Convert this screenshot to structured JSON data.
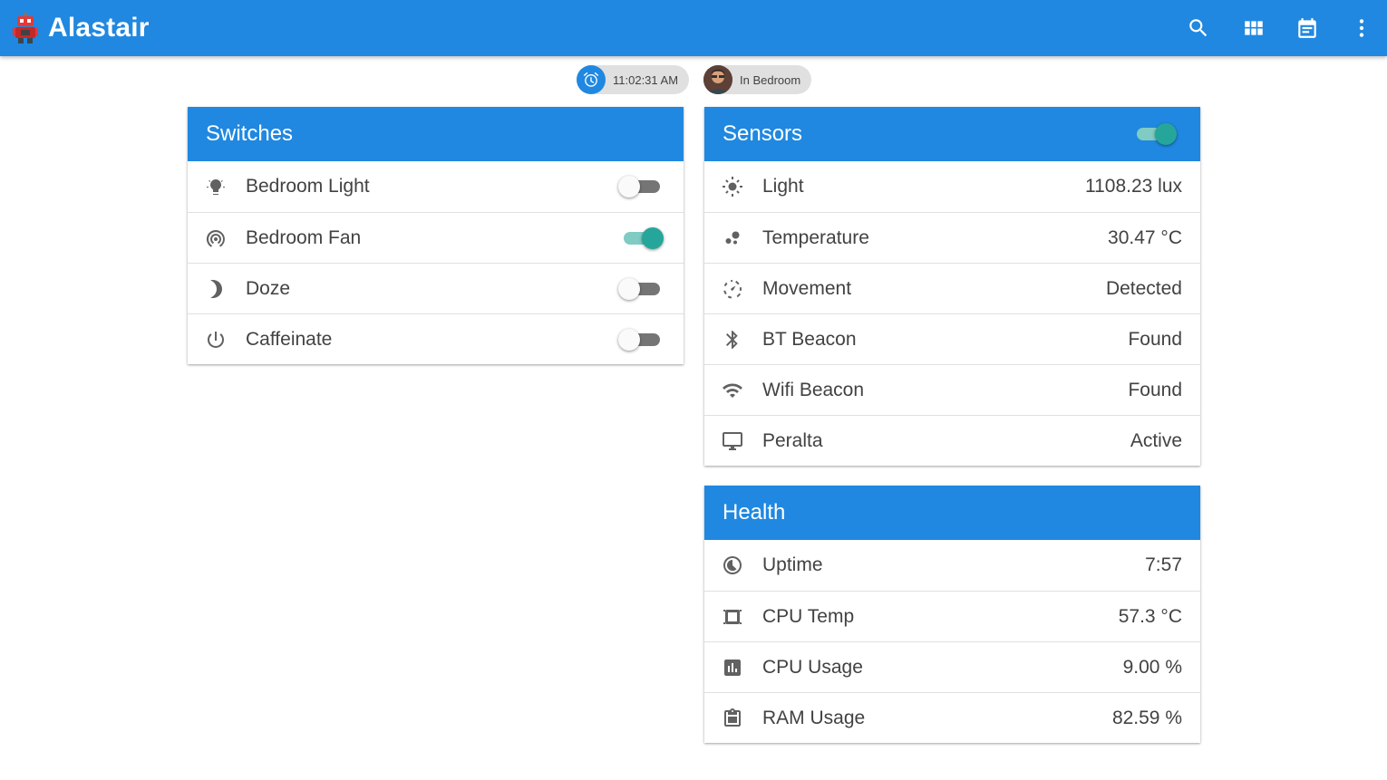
{
  "app": {
    "title": "Alastair"
  },
  "appbar_actions": [
    {
      "name": "search-icon"
    },
    {
      "name": "grid-icon"
    },
    {
      "name": "calendar-icon"
    },
    {
      "name": "more-vert-icon"
    }
  ],
  "chips": {
    "time": "11:02:31 AM",
    "presence": "In Bedroom"
  },
  "switches": {
    "title": "Switches",
    "items": [
      {
        "label": "Bedroom Light",
        "icon": "bulb-icon",
        "on": false
      },
      {
        "label": "Bedroom Fan",
        "icon": "fan-signal-icon",
        "on": true
      },
      {
        "label": "Doze",
        "icon": "moon-icon",
        "on": false
      },
      {
        "label": "Caffeinate",
        "icon": "power-icon",
        "on": false
      }
    ]
  },
  "sensors": {
    "title": "Sensors",
    "enabled": true,
    "items": [
      {
        "label": "Light",
        "value": "1108.23 lux",
        "icon": "sun-icon"
      },
      {
        "label": "Temperature",
        "value": "30.47 °C",
        "icon": "bubbles-icon"
      },
      {
        "label": "Movement",
        "value": "Detected",
        "icon": "motion-icon"
      },
      {
        "label": "BT Beacon",
        "value": "Found",
        "icon": "bluetooth-icon"
      },
      {
        "label": "Wifi Beacon",
        "value": "Found",
        "icon": "wifi-icon"
      },
      {
        "label": "Peralta",
        "value": "Active",
        "icon": "desktop-icon"
      }
    ]
  },
  "health": {
    "title": "Health",
    "items": [
      {
        "label": "Uptime",
        "value": "7:57",
        "icon": "uptime-icon"
      },
      {
        "label": "CPU Temp",
        "value": "57.3 °C",
        "icon": "chip-icon"
      },
      {
        "label": "CPU Usage",
        "value": "9.00 %",
        "icon": "bar-chart-icon"
      },
      {
        "label": "RAM Usage",
        "value": "82.59 %",
        "icon": "clipboard-icon"
      }
    ]
  },
  "colors": {
    "primary": "#2088e0",
    "accent": "#26a69a"
  }
}
